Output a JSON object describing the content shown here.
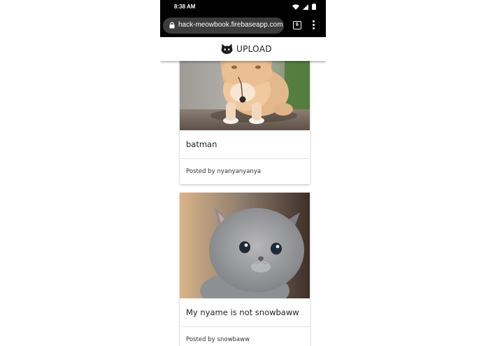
{
  "status_bar": {
    "time": "8:38 AM",
    "icons": [
      "wifi-icon",
      "signal-icon",
      "battery-icon"
    ]
  },
  "browser": {
    "url": "hack-meowbook.firebaseapp.com",
    "tab_count": "6",
    "icons": [
      "lock-icon",
      "tabs-icon",
      "menu-icon"
    ]
  },
  "app_bar": {
    "upload_label": "UPLOAD",
    "icon": "cat-face-icon"
  },
  "posts": [
    {
      "title": "batman",
      "posted_by_label": "Posted by",
      "author": "nyanyanyanya"
    },
    {
      "title": "My nyame is not snowbaww",
      "posted_by_label": "Posted by",
      "author": "snowbaww"
    }
  ],
  "colors": {
    "system_bar": "#000000",
    "url_bar": "#3c3c3c",
    "text": "#222222"
  }
}
